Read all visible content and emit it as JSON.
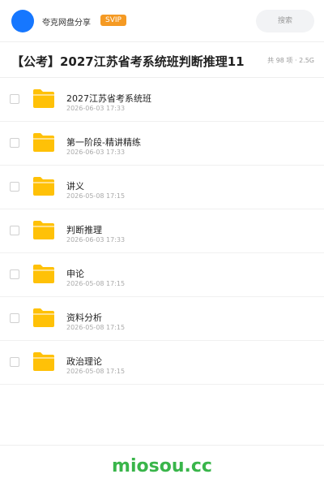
{
  "header": {
    "app_name": "夸克网盘分享",
    "badge": "SVIP",
    "search_placeholder": "搜索",
    "avatar_color": "#1677ff"
  },
  "folder": {
    "title": "【公考】2027江苏省考系统班判断推理11",
    "meta": "共 98 项 · 2.5G"
  },
  "items": [
    {
      "name": "2027江苏省考系统班",
      "date": "2026-06-03 17:33",
      "icon": "folder-icon"
    },
    {
      "name": "第一阶段-精讲精练",
      "date": "2026-06-03 17:33",
      "icon": "folder-icon"
    },
    {
      "name": "讲义",
      "date": "2026-05-08 17:15",
      "icon": "folder-icon"
    },
    {
      "name": "判断推理",
      "date": "2026-06-03 17:33",
      "icon": "folder-icon"
    },
    {
      "name": "申论",
      "date": "2026-05-08 17:15",
      "icon": "folder-icon"
    },
    {
      "name": "资料分析",
      "date": "2026-05-08 17:15",
      "icon": "folder-icon"
    },
    {
      "name": "政治理论",
      "date": "2026-05-08 17:15",
      "icon": "folder-icon"
    }
  ],
  "watermark": "miosou.cc",
  "colors": {
    "accent": "#1677ff",
    "badge": "#f59a23",
    "folder": "#ffc107",
    "watermark": "#39b54a"
  }
}
